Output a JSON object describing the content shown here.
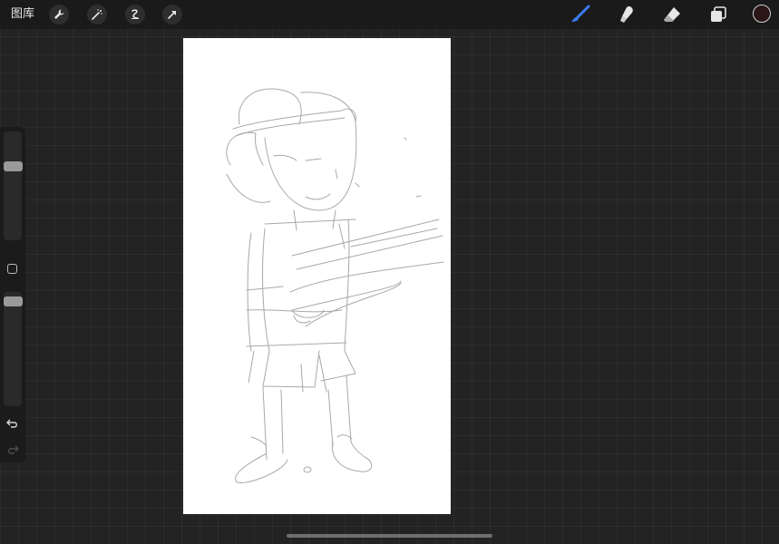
{
  "topbar": {
    "gallery_label": "图库",
    "left_tools": [
      "wrench-icon",
      "magic-wand-icon",
      "selection-icon",
      "transform-arrow-icon"
    ],
    "right_tools": [
      "brush-icon",
      "smudge-icon",
      "eraser-icon",
      "layers-icon"
    ],
    "active_tool": "brush-icon",
    "accent_color": "#3a7bf2",
    "current_color": "#2a1616"
  },
  "sidebar": {
    "brush_size_slider": {
      "level": 0.22
    },
    "opacity_slider": {
      "level": 0.06
    },
    "modifier_button": "square-modifier-icon",
    "undo": "undo-icon",
    "redo": "redo-icon"
  },
  "canvas": {
    "background": "#ffffff",
    "content": "pencil-sketch"
  }
}
